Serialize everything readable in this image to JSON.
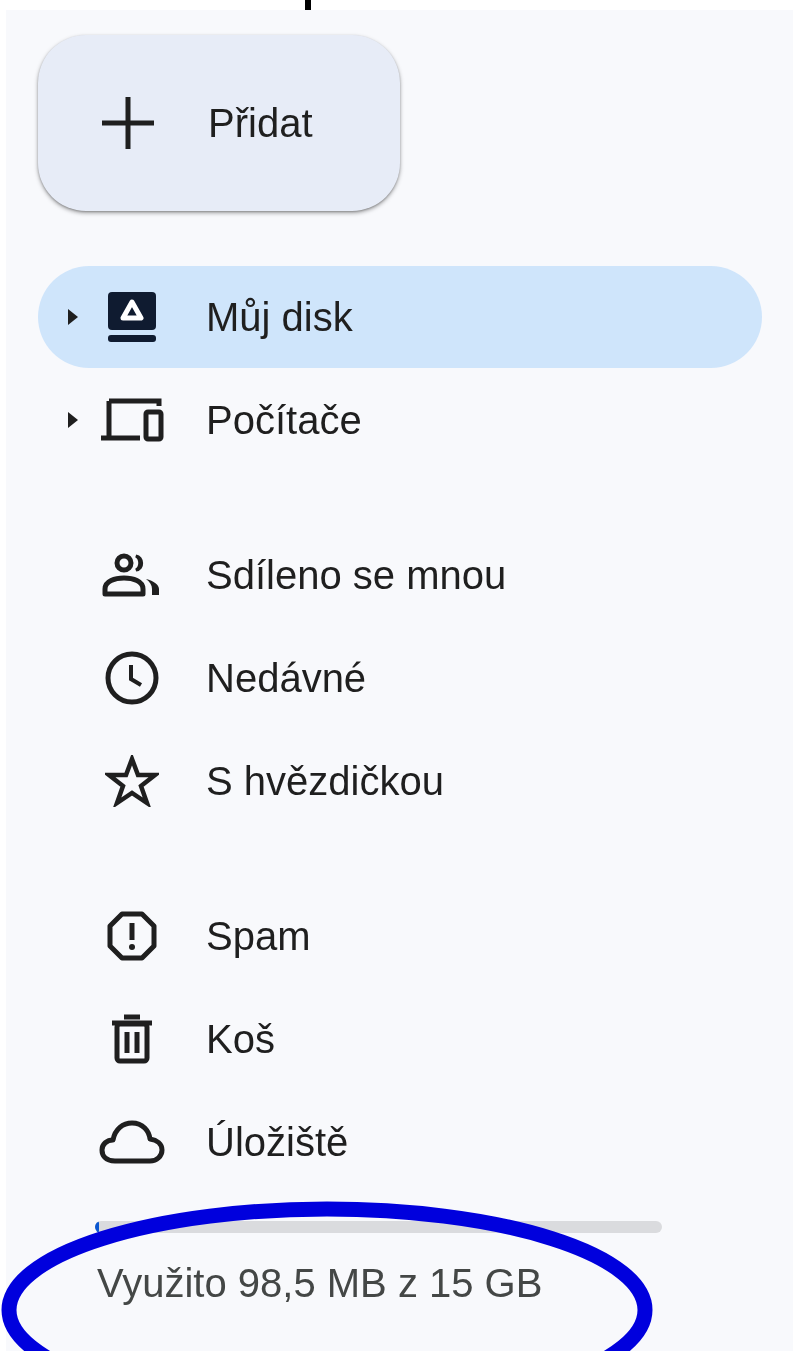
{
  "new_button": {
    "label": "Přidat"
  },
  "sections": [
    {
      "items": [
        {
          "label": "Můj disk",
          "kind": "tree",
          "expanded": false,
          "selected": true
        },
        {
          "label": "Počítače",
          "kind": "tree",
          "expanded": false,
          "selected": false
        }
      ]
    },
    {
      "items": [
        {
          "label": "Sdíleno se mnou",
          "kind": "link",
          "selected": false
        },
        {
          "label": "Nedávné",
          "kind": "link",
          "selected": false
        },
        {
          "label": "S hvězdičkou",
          "kind": "link",
          "selected": false
        }
      ]
    },
    {
      "items": [
        {
          "label": "Spam",
          "kind": "link",
          "selected": false
        },
        {
          "label": "Koš",
          "kind": "link",
          "selected": false
        },
        {
          "label": "Úložiště",
          "kind": "link",
          "selected": false
        }
      ]
    }
  ],
  "storage": {
    "level": 0.0066,
    "text": "Využito 98,5 MB z 15 GB"
  },
  "annotations": [
    {
      "kind": "ellipse"
    }
  ]
}
